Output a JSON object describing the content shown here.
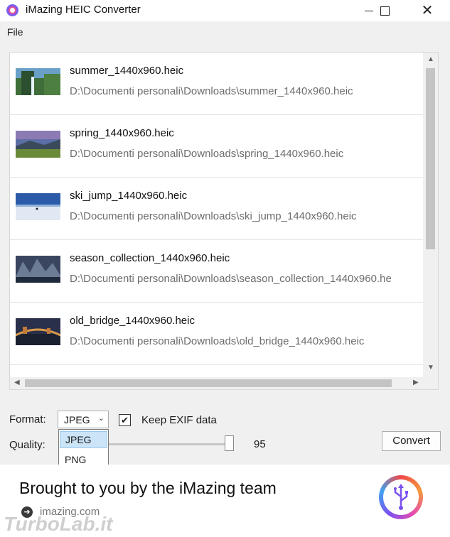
{
  "window": {
    "title": "iMazing HEIC Converter"
  },
  "menu": {
    "file_label": "File"
  },
  "files": [
    {
      "name": "summer_1440x960.heic",
      "path": "D:\\Documenti personali\\Downloads\\summer_1440x960.heic"
    },
    {
      "name": "spring_1440x960.heic",
      "path": "D:\\Documenti personali\\Downloads\\spring_1440x960.heic"
    },
    {
      "name": "ski_jump_1440x960.heic",
      "path": "D:\\Documenti personali\\Downloads\\ski_jump_1440x960.heic"
    },
    {
      "name": "season_collection_1440x960.heic",
      "path": "D:\\Documenti personali\\Downloads\\season_collection_1440x960.he"
    },
    {
      "name": "old_bridge_1440x960.heic",
      "path": "D:\\Documenti personali\\Downloads\\old_bridge_1440x960.heic"
    }
  ],
  "controls": {
    "format_label": "Format:",
    "format_selected": "JPEG",
    "format_options": [
      "JPEG",
      "PNG"
    ],
    "keep_exif_label": "Keep EXIF data",
    "keep_exif_checked": true,
    "quality_label": "Quality:",
    "quality_value": "95",
    "convert_label": "Convert"
  },
  "banner": {
    "text": "Brought to you by the iMazing team",
    "link": "imazing.com"
  },
  "watermark": "TurboLab.it",
  "icons": [
    "app-icon",
    "minimize-icon",
    "maximize-icon",
    "close-icon",
    "chevron-down-icon",
    "checkmark-icon",
    "arrow-right-icon",
    "imazing-usb-logo-icon"
  ]
}
